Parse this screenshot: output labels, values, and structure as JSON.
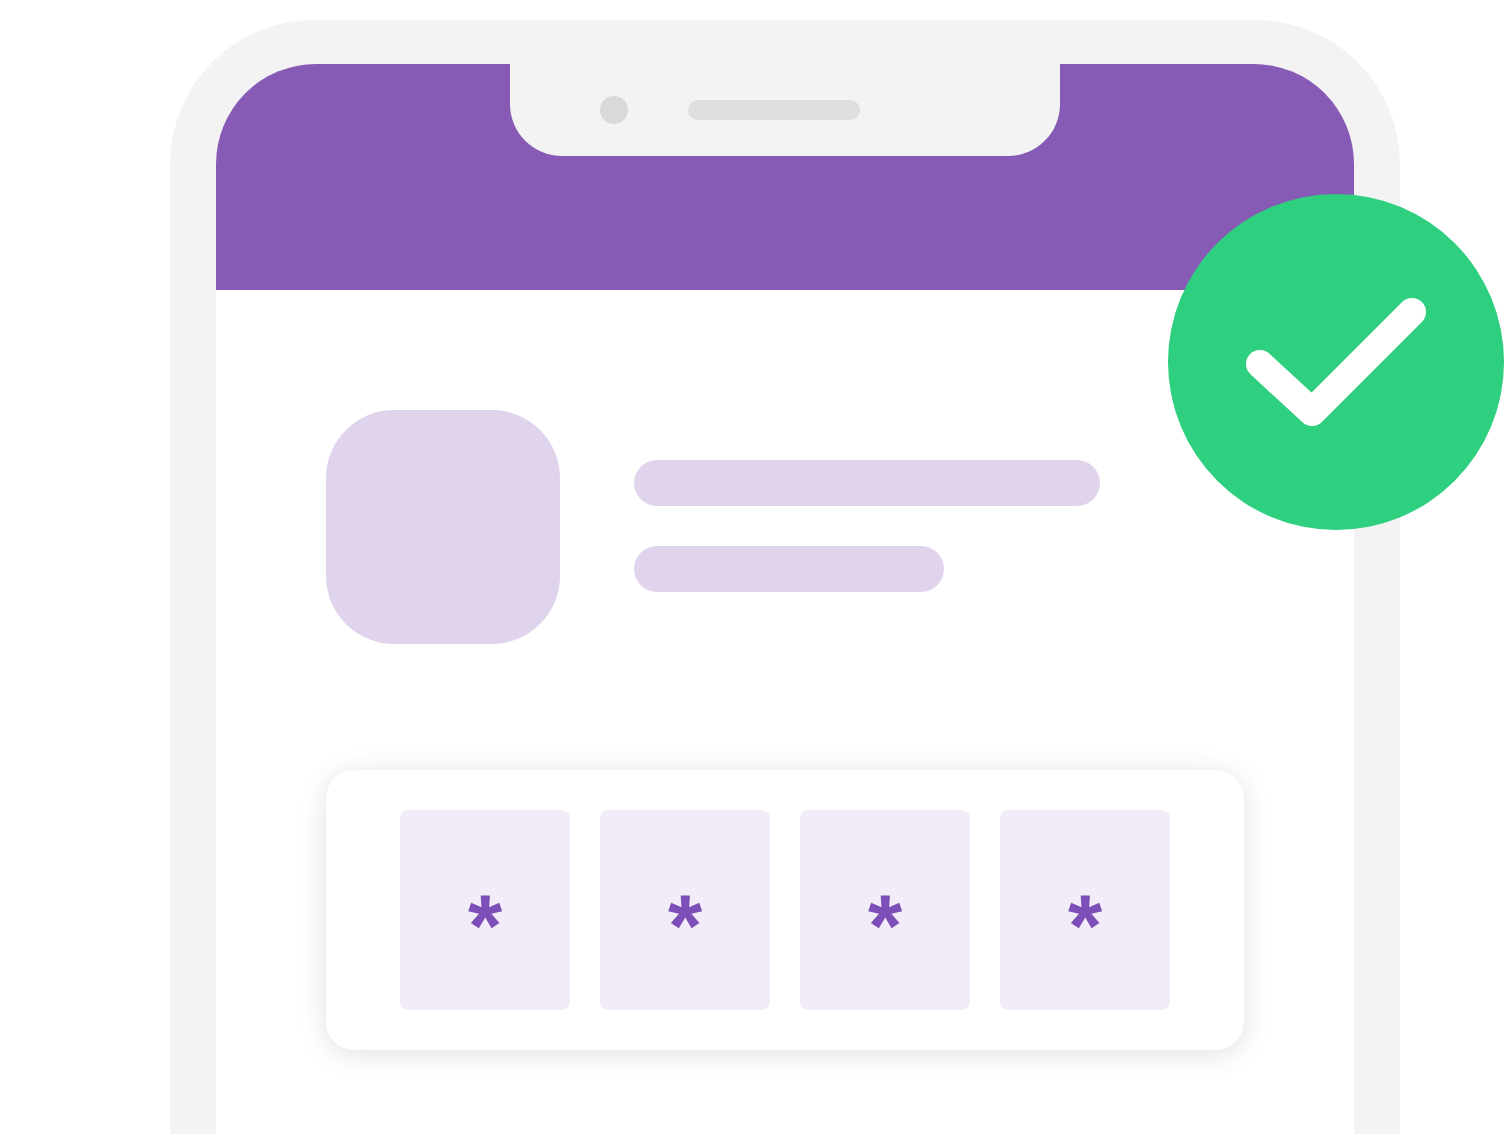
{
  "pin_entry": {
    "digits": [
      "*",
      "*",
      "*",
      "*"
    ]
  }
}
